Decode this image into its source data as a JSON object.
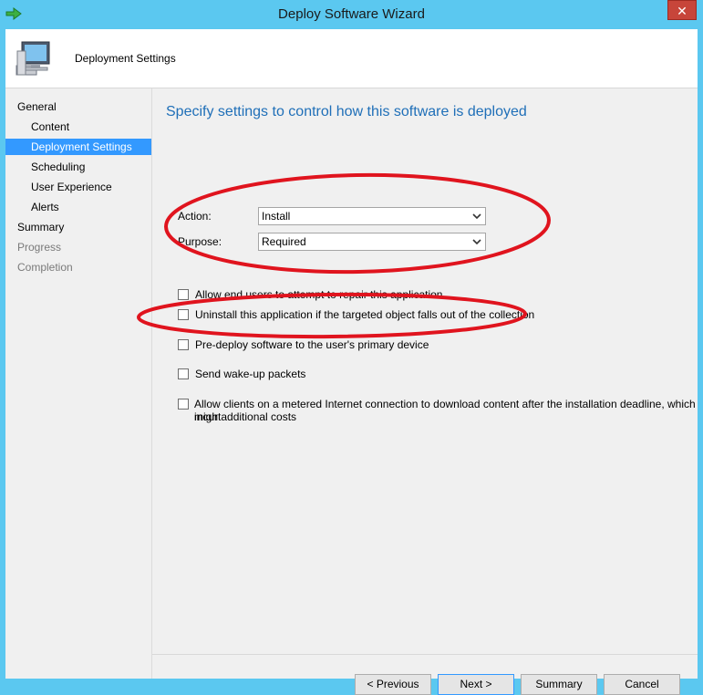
{
  "window": {
    "title": "Deploy Software Wizard",
    "close_symbol": "✕"
  },
  "header": {
    "title": "Deployment Settings"
  },
  "sidebar": {
    "items": [
      {
        "label": "General"
      },
      {
        "label": "Content"
      },
      {
        "label": "Deployment Settings"
      },
      {
        "label": "Scheduling"
      },
      {
        "label": "User Experience"
      },
      {
        "label": "Alerts"
      },
      {
        "label": "Summary"
      },
      {
        "label": "Progress"
      },
      {
        "label": "Completion"
      }
    ]
  },
  "main": {
    "heading": "Specify settings to control how this software is deployed",
    "action": {
      "label": "Action:",
      "value": "Install"
    },
    "purpose": {
      "label": "Purpose:",
      "value": "Required"
    },
    "checkboxes": [
      {
        "label": "Allow end users to attempt to repair this application",
        "checked": false
      },
      {
        "label": "Uninstall this application if the targeted object falls out of the collection",
        "checked": false
      },
      {
        "label": "Pre-deploy software to the user's primary device",
        "checked": false
      },
      {
        "label": "Send wake-up packets",
        "checked": false
      },
      {
        "label": "Allow clients on a metered Internet connection to download content after the installation deadline, which might",
        "label_line2": "incur additional costs",
        "checked": false
      }
    ]
  },
  "buttons": {
    "previous": "< Previous",
    "next": "Next >",
    "summary": "Summary",
    "cancel": "Cancel"
  },
  "colors": {
    "window_frame": "#5bc8f0",
    "accent_blue": "#1f6fb8",
    "selection": "#3399ff",
    "annotation_red": "#e0141e"
  },
  "icons": {
    "title_icon": "green-arrow-icon",
    "header_icon": "computer-icon",
    "dropdown": "chevron-down-icon"
  }
}
